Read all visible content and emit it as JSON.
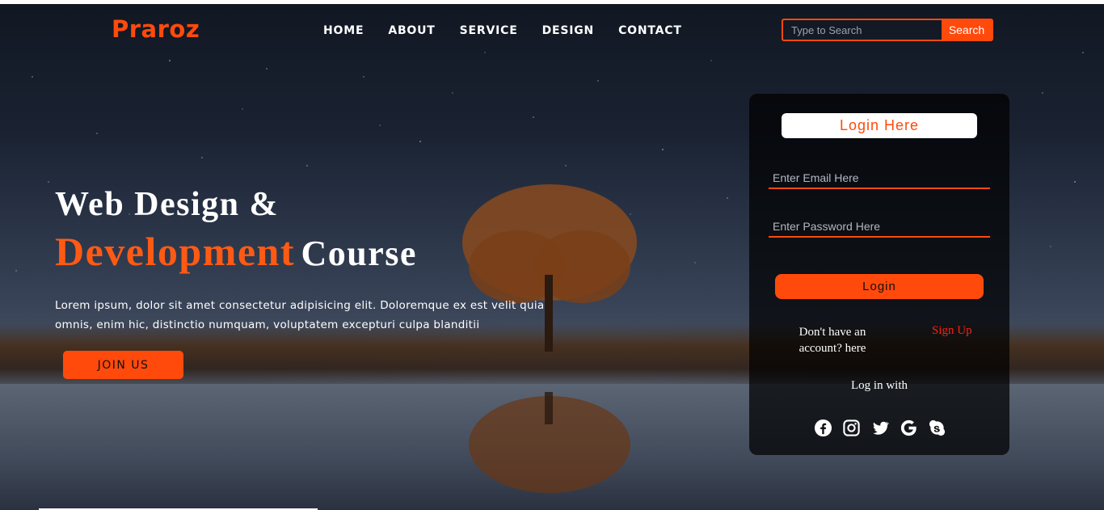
{
  "brand": {
    "name": "Praroz"
  },
  "nav": {
    "items": [
      {
        "label": "HOME"
      },
      {
        "label": "ABOUT"
      },
      {
        "label": "SERVICE"
      },
      {
        "label": "DESIGN"
      },
      {
        "label": "CONTACT"
      }
    ]
  },
  "search": {
    "placeholder": "Type to Search",
    "button_label": "Search"
  },
  "hero": {
    "line1": "Web Design &",
    "accent": "Development",
    "rest": "Course",
    "description": "Lorem ipsum, dolor sit amet consectetur adipisicing elit. Doloremque ex est velit quia omnis, enim hic, distinctio numquam, voluptatem excepturi culpa blanditii",
    "join_label": "JOIN US"
  },
  "login": {
    "title": "Login Here",
    "email_placeholder": "Enter Email Here",
    "password_placeholder": "Enter Password Here",
    "button_label": "Login",
    "no_account_text": "Don't have an account? here",
    "signup_label": "Sign Up",
    "login_with": "Log in with",
    "socials": [
      "facebook-icon",
      "instagram-icon",
      "twitter-icon",
      "google-icon",
      "skype-icon"
    ]
  },
  "colors": {
    "accent": "#ff4a0c",
    "signup": "#ff1f0f"
  }
}
